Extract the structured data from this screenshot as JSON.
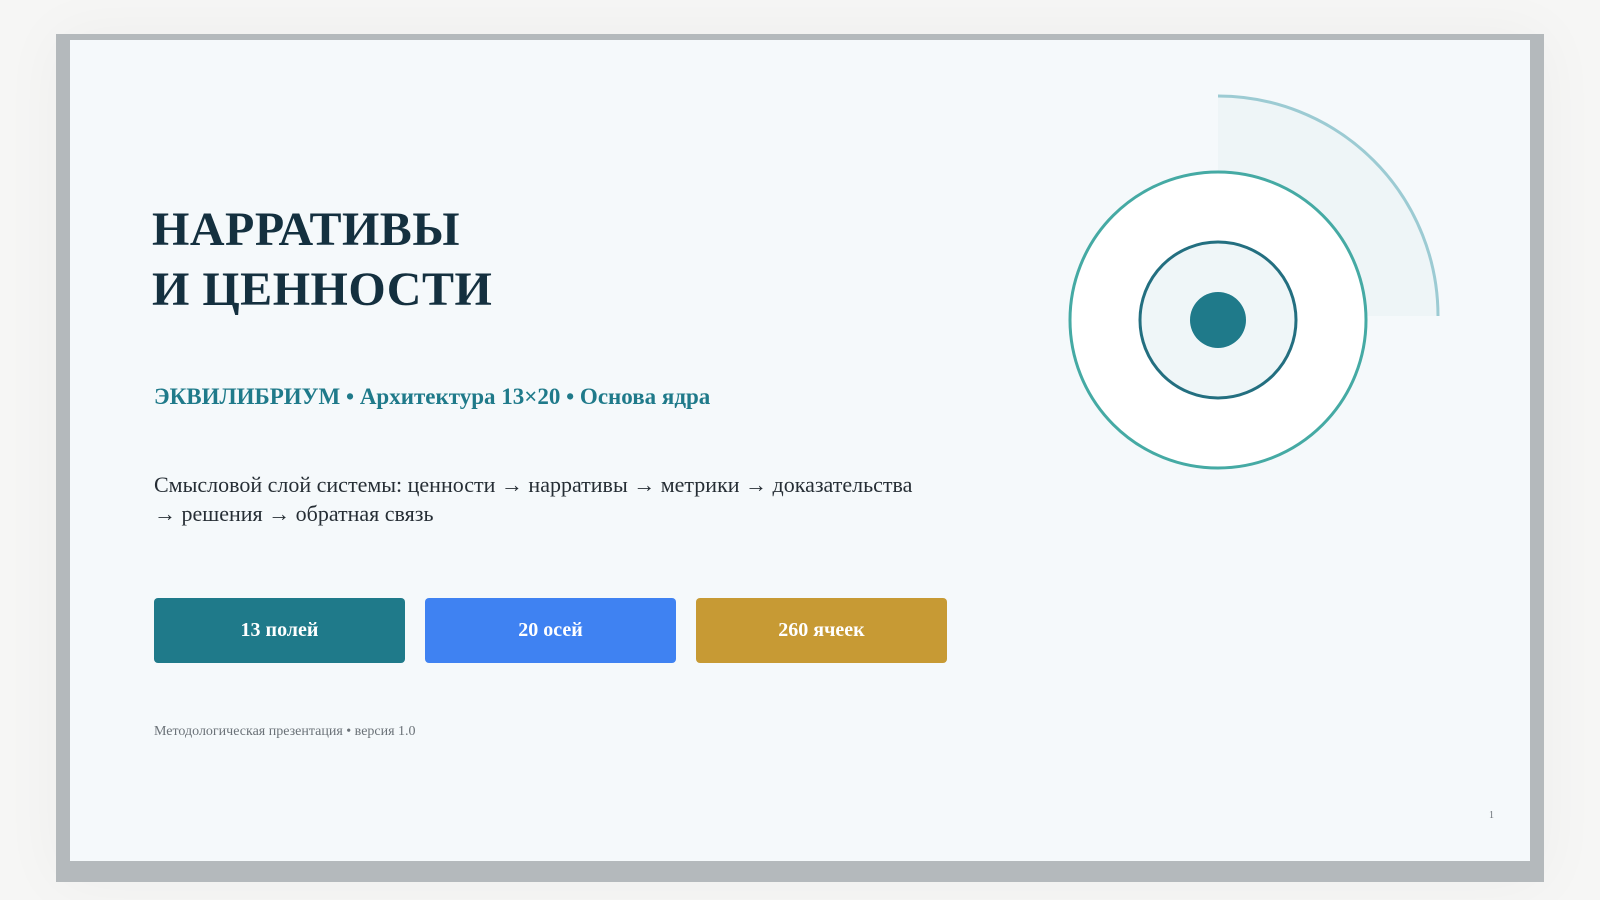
{
  "slide": {
    "title_lines": [
      "НАРРАТИВЫ",
      "И ЦЕННОСТИ"
    ],
    "subtitle": "ЭКВИЛИБРИУМ • Архитектура 13×20 • Основа ядра",
    "description": "Смысловой слой системы: ценности → нарративы → метрики → доказательства → решения → обратная связь",
    "stats": [
      {
        "label": "13 полей",
        "color": "#1f7a8a"
      },
      {
        "label": "20 осей",
        "color": "#3f82f2"
      },
      {
        "label": "260 ячеек",
        "color": "#c79a34"
      }
    ],
    "footer_note": "Методологическая презентация • версия 1.0",
    "page_number": "1"
  },
  "colors": {
    "title": "#14303f",
    "accent_teal": "#1f7a8a",
    "ring_light_teal": "#45aaa4",
    "arc_light": "#9ccbd3",
    "frame_border": "#b4b9bc",
    "slide_background": "#f5f9fb"
  },
  "emblem": {
    "icon": "concentric-target-icon"
  }
}
